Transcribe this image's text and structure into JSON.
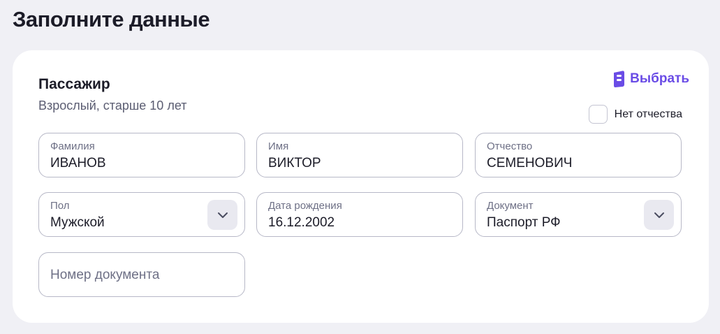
{
  "page": {
    "title": "Заполните данные"
  },
  "passenger": {
    "title": "Пассажир",
    "subtitle": "Взрослый, старше 10 лет",
    "choose_label": "Выбрать",
    "no_patronymic_label": "Нет отчества",
    "no_patronymic_checked": false
  },
  "fields": {
    "last_name": {
      "label": "Фамилия",
      "value": "ИВАНОВ"
    },
    "first_name": {
      "label": "Имя",
      "value": "ВИКТОР"
    },
    "patronymic": {
      "label": "Отчество",
      "value": "СЕМЕНОВИЧ"
    },
    "gender": {
      "label": "Пол",
      "value": "Мужской"
    },
    "birth_date": {
      "label": "Дата рождения",
      "value": "16.12.2002"
    },
    "document": {
      "label": "Документ",
      "value": "Паспорт РФ"
    },
    "document_number": {
      "placeholder": "Номер документа",
      "value": ""
    }
  },
  "icons": {
    "choose": "passenger-card-icon",
    "dropdown": "chevron-down-icon"
  },
  "colors": {
    "accent": "#6a4ce6",
    "text": "#1c1c28",
    "muted": "#6e7086",
    "border": "#b7b8c7"
  }
}
